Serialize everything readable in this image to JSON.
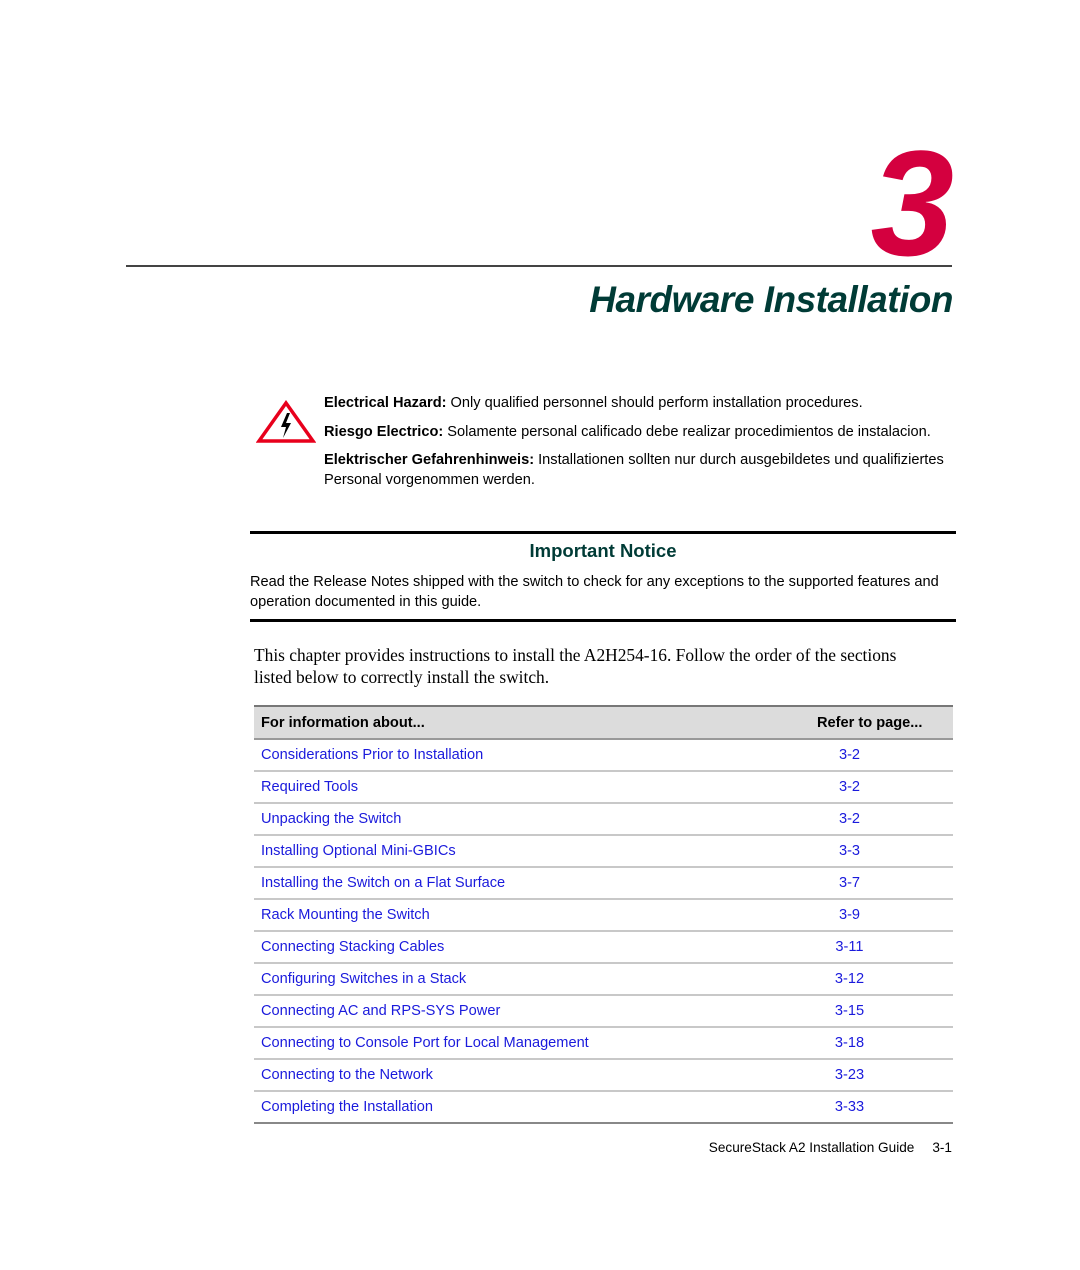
{
  "chapter": {
    "number": "3",
    "title": "Hardware Installation",
    "accent_color": "#d4003f",
    "title_color": "#003b36"
  },
  "hazard": {
    "icon": "electrical-hazard-icon",
    "warnings": [
      {
        "label": "Electrical Hazard:",
        "text": " Only qualified personnel should perform installation procedures."
      },
      {
        "label": "Riesgo Electrico:",
        "text": " Solamente personal calificado debe realizar procedimientos de instalacion."
      },
      {
        "label": "Elektrischer Gefahrenhinweis:",
        "text": " Installationen sollten nur durch ausgebildetes und qualifiziertes Personal vorgenommen werden."
      }
    ]
  },
  "notice": {
    "title": "Important Notice",
    "body": "Read the Release Notes shipped with the switch to check for any exceptions to the supported features and operation documented in this guide."
  },
  "intro": "This chapter provides instructions to install the A2H254-16. Follow the order of the sections listed below to correctly install the switch.",
  "toc": {
    "header_topic": "For information about...",
    "header_page": "Refer to page...",
    "link_color": "#1a1adc",
    "rows": [
      {
        "topic": "Considerations Prior to Installation",
        "page": "3-2"
      },
      {
        "topic": "Required Tools",
        "page": "3-2"
      },
      {
        "topic": "Unpacking the Switch",
        "page": "3-2"
      },
      {
        "topic": "Installing Optional Mini-GBICs",
        "page": "3-3"
      },
      {
        "topic": "Installing the Switch on a Flat Surface",
        "page": "3-7"
      },
      {
        "topic": "Rack Mounting the Switch",
        "page": "3-9"
      },
      {
        "topic": "Connecting Stacking Cables",
        "page": "3-11"
      },
      {
        "topic": "Configuring Switches in a Stack",
        "page": "3-12"
      },
      {
        "topic": "Connecting AC and RPS-SYS Power",
        "page": "3-15"
      },
      {
        "topic": "Connecting to Console Port for Local Management",
        "page": "3-18"
      },
      {
        "topic": "Connecting to the Network",
        "page": "3-23"
      },
      {
        "topic": "Completing the Installation",
        "page": "3-33"
      }
    ]
  },
  "footer": {
    "guide_title": "SecureStack A2 Installation Guide",
    "page": "3-1"
  }
}
